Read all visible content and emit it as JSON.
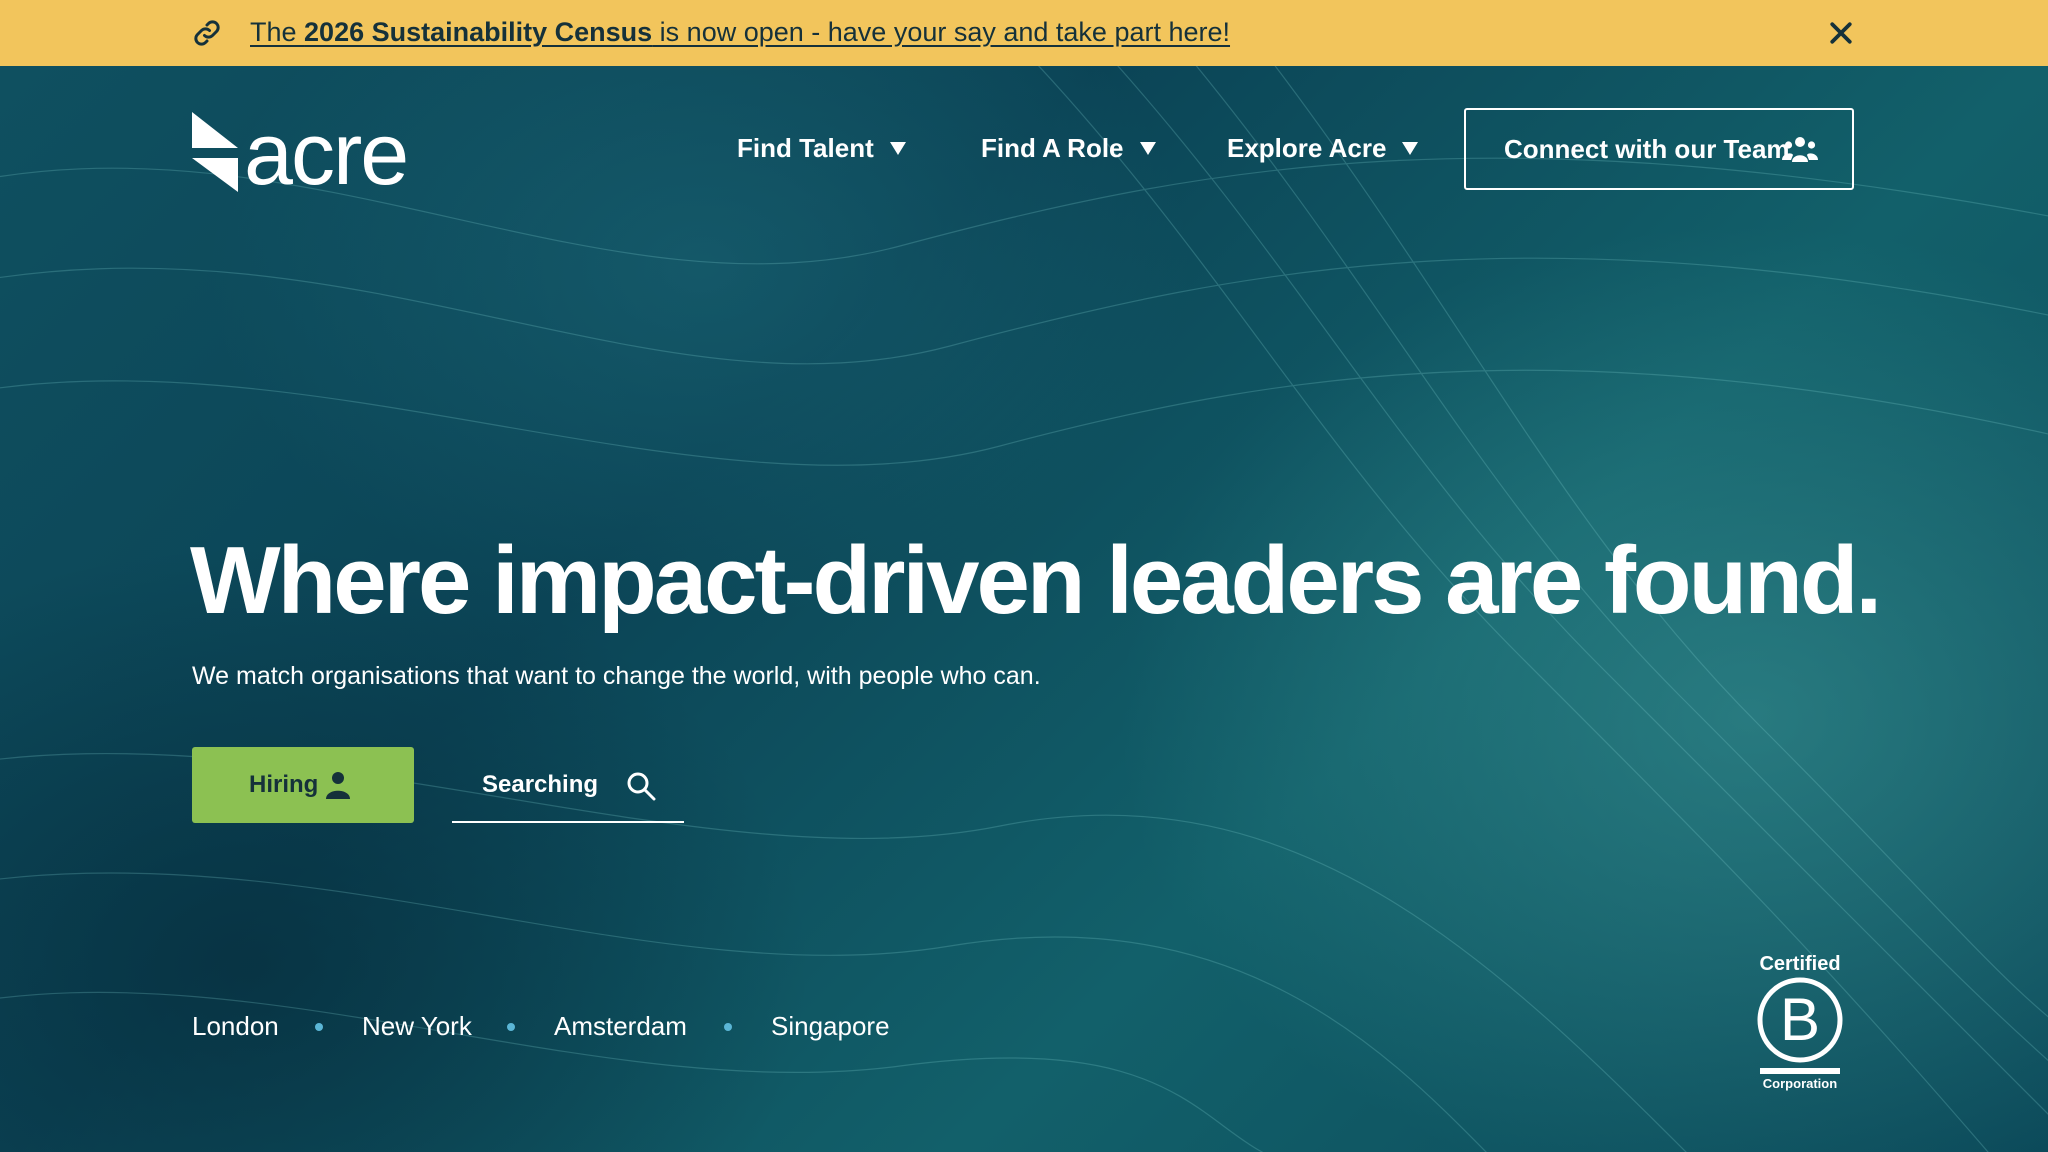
{
  "banner": {
    "text_before": "The ",
    "text_bold": "2026 Sustainability Census",
    "text_after": " is now open - have your say and take part here!",
    "link_icon": "link-icon",
    "close_icon": "close-icon"
  },
  "header": {
    "logo_text": "acre",
    "nav": [
      {
        "label": "Find Talent"
      },
      {
        "label": "Find A Role"
      },
      {
        "label": "Explore Acre"
      }
    ],
    "cta_label": "Connect with our Team",
    "cta_icon": "team-icon"
  },
  "hero": {
    "headline": "Where impact-driven leaders are found.",
    "subline": "We match organisations that want to change the world, with people who can.",
    "hiring_label": "Hiring",
    "hiring_icon": "person-icon",
    "searching_label": "Searching",
    "searching_icon": "search-icon"
  },
  "locations": [
    "London",
    "New York",
    "Amsterdam",
    "Singapore"
  ],
  "bcorp": {
    "top": "Certified",
    "letter": "B",
    "bottom": "Corporation"
  },
  "colors": {
    "banner": "#f2c55c",
    "hero": "#0d4a5c",
    "hiring_button": "#8cc152",
    "location_dot": "#5bb6d6"
  }
}
